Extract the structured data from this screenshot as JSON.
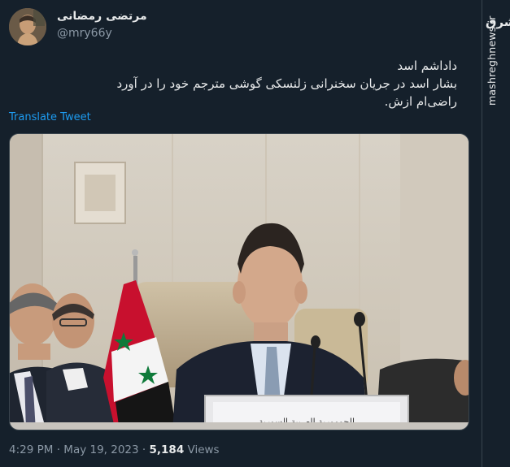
{
  "tweet": {
    "author": {
      "display_name": "مرتضی رمضانی",
      "handle": "@mry66y"
    },
    "text_lines": [
      "داداشم اسد",
      "بشار اسد در جریان سخنرانی زلنسکی گوشی مترجم خود را در آورد",
      "راضی‌ام ازش."
    ],
    "translate_label": "Translate Tweet",
    "media": {
      "placard_text": "الجمهورية العربية السورية"
    },
    "time": "4:29 PM",
    "separator": "·",
    "date": "May 19, 2023",
    "views_count": "5,184",
    "views_label": "Views"
  },
  "watermark": {
    "logo_text": "مشرق",
    "site": "mashreghnews.ir"
  },
  "colors": {
    "background": "#15202b",
    "text": "#e7e9ea",
    "secondary": "#8b98a5",
    "link": "#1d9bf0",
    "border": "#38444d"
  }
}
